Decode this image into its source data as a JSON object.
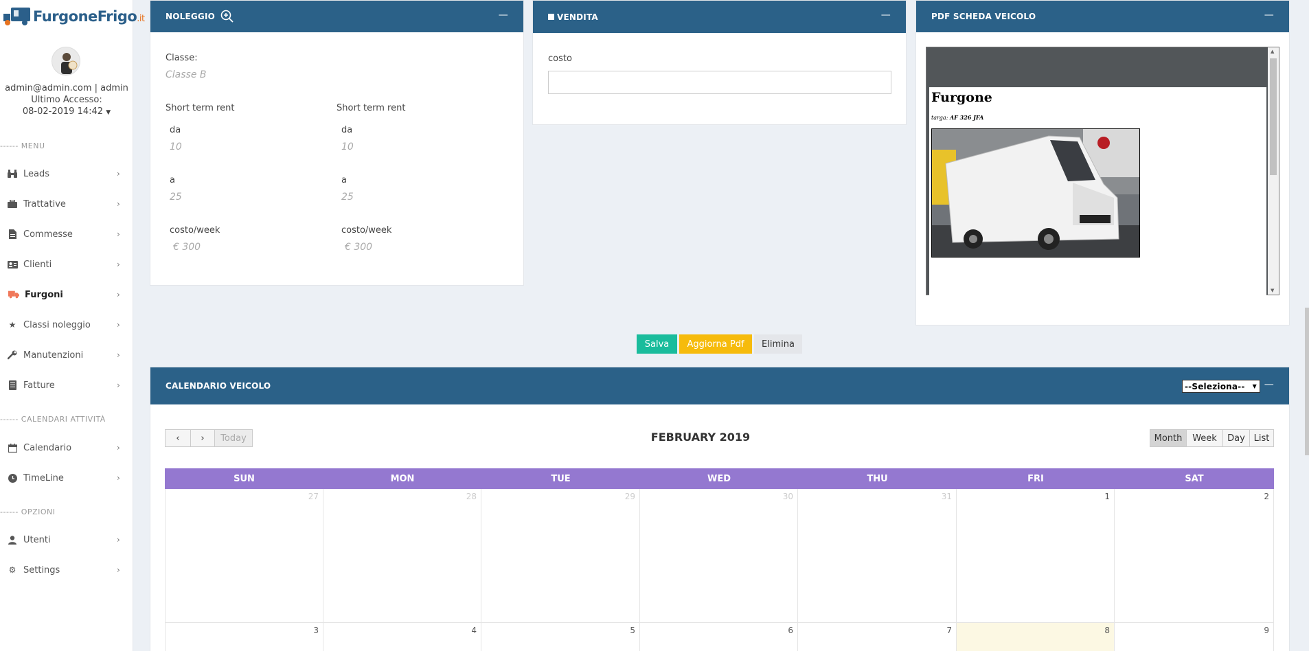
{
  "brand": {
    "name": "FurgoneFrigo",
    "tld": ".it"
  },
  "user": {
    "line1": "admin@admin.com | admin",
    "line2": "Ultimo Accesso:",
    "line3": "08-02-2019 14:42"
  },
  "sidebar": {
    "section_menu": "------ MENU",
    "section_calendari": "------ CALENDARI ATTIVITÀ",
    "section_opzioni": "------ OPZIONI",
    "items": [
      {
        "label": "Leads",
        "icon": "binoculars-icon"
      },
      {
        "label": "Trattative",
        "icon": "briefcase-icon"
      },
      {
        "label": "Commesse",
        "icon": "file-icon"
      },
      {
        "label": "Clienti",
        "icon": "address-card-icon"
      },
      {
        "label": "Furgoni",
        "icon": "truck-icon"
      },
      {
        "label": "Classi noleggio",
        "icon": "star-icon"
      },
      {
        "label": "Manutenzioni",
        "icon": "wrench-icon"
      },
      {
        "label": "Fatture",
        "icon": "invoice-icon"
      },
      {
        "label": "Calendario",
        "icon": "calendar-icon"
      },
      {
        "label": "TimeLine",
        "icon": "clock-icon"
      },
      {
        "label": "Utenti",
        "icon": "user-icon"
      },
      {
        "label": "Settings",
        "icon": "gear-icon"
      }
    ]
  },
  "noleggio": {
    "title": "NOLEGGIO",
    "classe_label": "Classe:",
    "classe_value": "Classe B",
    "col1": {
      "title": "Short term rent",
      "da_label": "da",
      "da_value": "10",
      "a_label": "a",
      "a_value": "25",
      "costo_label": "costo/week",
      "costo_value": "€  300"
    },
    "col2": {
      "title": "Short term rent",
      "da_label": "da",
      "da_value": "10",
      "a_label": "a",
      "a_value": "25",
      "costo_label": "costo/week",
      "costo_value": "€  300"
    }
  },
  "vendita": {
    "title": "VENDITA",
    "costo_label": "costo",
    "costo_value": ""
  },
  "pdf": {
    "title": "PDF SCHEDA VEICOLO",
    "doc_title": "Furgone",
    "targa_label": "targa:",
    "targa_value": "AF 326 JFA"
  },
  "actions": {
    "save": "Salva",
    "update_pdf": "Aggiorna Pdf",
    "delete": "Elimina"
  },
  "calendar": {
    "title": "CALENDARIO VEICOLO",
    "select_value": "--Seleziona--",
    "month_title": "FEBRUARY 2019",
    "today": "Today",
    "views": [
      "Month",
      "Week",
      "Day",
      "List"
    ],
    "days": [
      "SUN",
      "MON",
      "TUE",
      "WED",
      "THU",
      "FRI",
      "SAT"
    ],
    "week1": [
      "27",
      "28",
      "29",
      "30",
      "31",
      "1",
      "2"
    ],
    "week2": [
      "3",
      "4",
      "5",
      "6",
      "7",
      "8",
      "9"
    ]
  },
  "colors": {
    "header": "#2b6188",
    "save": "#1abc9c",
    "update": "#f6bb0c",
    "day_header": "#9478d0",
    "today_bg": "#fcf8e3"
  }
}
